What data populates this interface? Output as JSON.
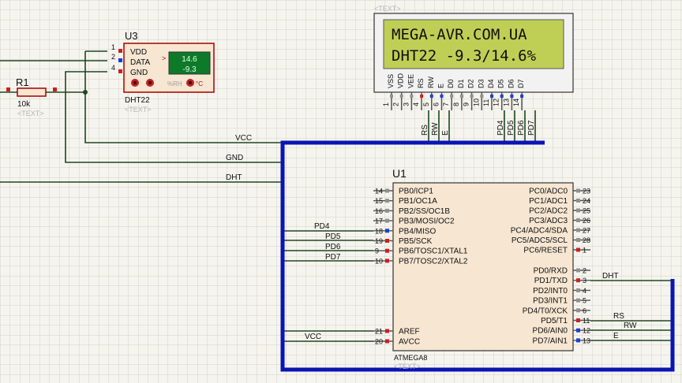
{
  "colors": {
    "background": "#f5f4ee",
    "grid": "#d4d3cb",
    "wire": "#1e4620",
    "bus": "#0a14b4",
    "component_body": "#f6e6d2",
    "component_border": "#a30000",
    "lcd_screen": "#bfcf55",
    "lcd_frame": "#f2f2f2",
    "pin_red": "#d01e1e",
    "pin_blue": "#1b3fd6",
    "pin_gray": "#909090",
    "ghost_text": "#b5b5b5"
  },
  "lcd": {
    "ref_text": "<TEXT>",
    "line1": "MEGA-AVR.COM.UA",
    "line2": "DHT22 -9.3/14.6%",
    "pin_names": [
      "VSS",
      "VDD",
      "VEE",
      "RS",
      "RW",
      "E",
      "D0",
      "D1",
      "D2",
      "D3",
      "D4",
      "D5",
      "D6",
      "D7"
    ],
    "pin_numbers": [
      "1",
      "2",
      "3",
      "4",
      "5",
      "6",
      "7",
      "8",
      "9",
      "10",
      "11",
      "12",
      "13",
      "14"
    ],
    "wire_labels": [
      "RS",
      "RW",
      "E",
      "PD4",
      "PD5",
      "PD6",
      "PD7"
    ]
  },
  "sensor": {
    "ref": "U3",
    "part": "DHT22",
    "text": "<TEXT>",
    "pins": [
      "VDD",
      "DATA",
      "GND"
    ],
    "pin_numbers": [
      "1",
      "2",
      "4"
    ],
    "display_top": "14.6",
    "display_bottom": "-9.3",
    "arrow": ">",
    "unit_rh": "%RH",
    "unit_c": "°C"
  },
  "resistor": {
    "ref": "R1",
    "value": "10k",
    "text": "<TEXT>"
  },
  "nets": {
    "vcc": "VCC",
    "gnd": "GND",
    "dht": "DHT"
  },
  "mcu": {
    "ref": "U1",
    "part": "ATMEGA8",
    "text": "<TEXT>",
    "left_pins": [
      {
        "num": "14",
        "name": "PB0/ICP1"
      },
      {
        "num": "15",
        "name": "PB1/OC1A"
      },
      {
        "num": "16",
        "name": "PB2/SS/OC1B"
      },
      {
        "num": "17",
        "name": "PB3/MOSI/OC2"
      },
      {
        "num": "18",
        "name": "PB4/MISO"
      },
      {
        "num": "19",
        "name": "PB5/SCK"
      },
      {
        "num": "9",
        "name": "PB6/TOSC1/XTAL1"
      },
      {
        "num": "10",
        "name": "PB7/TOSC2/XTAL2"
      }
    ],
    "left_bottom_pins": [
      {
        "num": "21",
        "name": "AREF"
      },
      {
        "num": "20",
        "name": "AVCC"
      }
    ],
    "right_pins": [
      {
        "num": "23",
        "name": "PC0/ADC0"
      },
      {
        "num": "24",
        "name": "PC1/ADC1"
      },
      {
        "num": "25",
        "name": "PC2/ADC2"
      },
      {
        "num": "26",
        "name": "PC3/ADC3"
      },
      {
        "num": "27",
        "name": "PC4/ADC4/SDA"
      },
      {
        "num": "28",
        "name": "PC5/ADC5/SCL"
      },
      {
        "num": "1",
        "name": "PC6/RESET"
      }
    ],
    "right_bottom_pins": [
      {
        "num": "2",
        "name": "PD0/RXD"
      },
      {
        "num": "3",
        "name": "PD1/TXD"
      },
      {
        "num": "4",
        "name": "PD2/INT0"
      },
      {
        "num": "5",
        "name": "PD3/INT1"
      },
      {
        "num": "6",
        "name": "PD4/T0/XCK"
      },
      {
        "num": "11",
        "name": "PD5/T1"
      },
      {
        "num": "12",
        "name": "PD6/AIN0"
      },
      {
        "num": "13",
        "name": "PD7/AIN1"
      }
    ],
    "left_wire_labels": [
      "PD4",
      "PD5",
      "PD6",
      "PD7",
      "VCC"
    ],
    "right_wire_labels": [
      "DHT",
      "RS",
      "RW",
      "E"
    ]
  }
}
